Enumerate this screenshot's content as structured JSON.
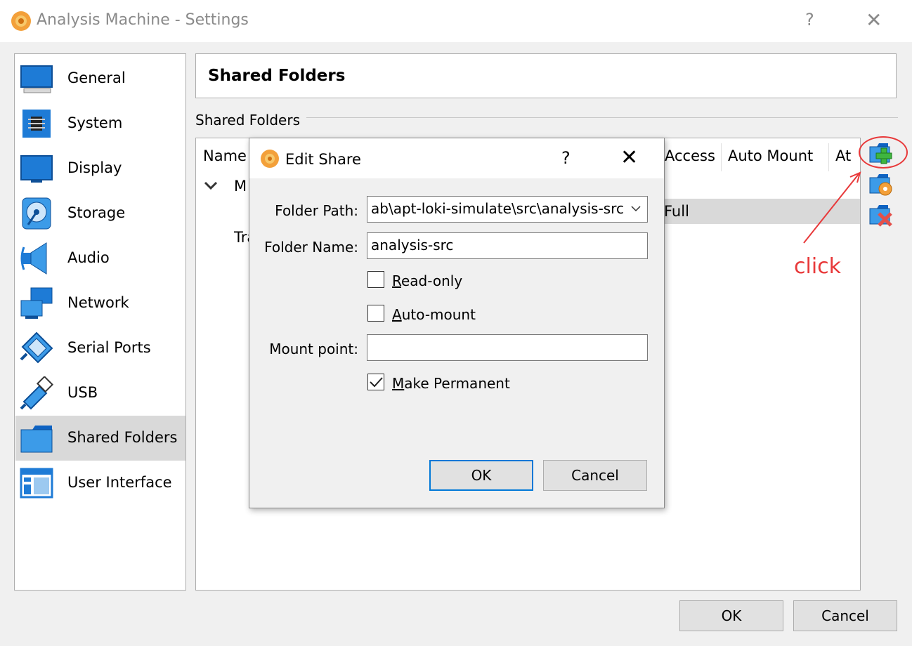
{
  "window": {
    "title": "Analysis Machine - Settings",
    "help": "?",
    "close": "✕"
  },
  "sidebar": {
    "items": [
      {
        "label": "General",
        "icon": "monitor-icon"
      },
      {
        "label": "System",
        "icon": "chip-icon"
      },
      {
        "label": "Display",
        "icon": "display-icon"
      },
      {
        "label": "Storage",
        "icon": "disk-icon"
      },
      {
        "label": "Audio",
        "icon": "speaker-icon"
      },
      {
        "label": "Network",
        "icon": "network-icon"
      },
      {
        "label": "Serial Ports",
        "icon": "serial-port-icon"
      },
      {
        "label": "USB",
        "icon": "usb-icon"
      },
      {
        "label": "Shared Folders",
        "icon": "folder-icon",
        "selected": true
      },
      {
        "label": "User Interface",
        "icon": "window-icon"
      }
    ]
  },
  "main": {
    "page_title": "Shared Folders",
    "group_label": "Shared Folders",
    "columns": [
      "Name",
      "Access",
      "Auto Mount",
      "At"
    ],
    "tree": {
      "expander": "⌄",
      "row1_partial": "M",
      "row2_partial": "Tra",
      "access_value": "Full"
    },
    "toolbar": {
      "add": "add-share-icon",
      "edit": "edit-share-icon",
      "remove": "remove-share-icon"
    },
    "annotation": "click",
    "annotation_color": "#e8393a"
  },
  "dialog": {
    "title": "Edit Share",
    "help": "?",
    "close": "✕",
    "folder_path_label": "Folder Path:",
    "folder_path_value": "ab\\apt-loki-simulate\\src\\analysis-src",
    "folder_name_label": "Folder Name:",
    "folder_name_value": "analysis-src",
    "read_only": {
      "label_first": "R",
      "label_rest": "ead-only",
      "checked": false
    },
    "auto_mount": {
      "label_first": "A",
      "label_rest": "uto-mount",
      "checked": false
    },
    "mount_point_label": "Mount point:",
    "mount_point_value": "",
    "make_permanent": {
      "label_first": "M",
      "label_rest": "ake Permanent",
      "checked": true
    },
    "ok": "OK",
    "cancel": "Cancel"
  },
  "footer": {
    "ok": "OK",
    "cancel": "Cancel"
  }
}
